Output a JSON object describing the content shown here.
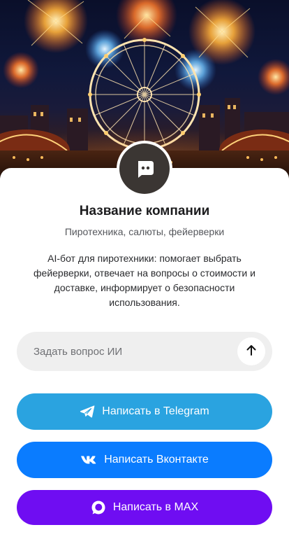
{
  "profile": {
    "name": "Название компании",
    "subtitle": "Пиротехника, салюты, фейерверки",
    "description": "AI-бот для пиротехники: помогает выбрать фейерверки, отвечает на вопросы о стоимости и доставке, информирует о безопасности использования."
  },
  "ask": {
    "placeholder": "Задать вопрос ИИ",
    "send_icon": "arrow-up-icon"
  },
  "buttons": {
    "telegram": {
      "label": "Написать в Telegram",
      "icon": "telegram-icon",
      "color": "#2aa3e0"
    },
    "vk": {
      "label": "Написать Вконтакте",
      "icon": "vk-icon",
      "color": "#0a7cff"
    },
    "max": {
      "label": "Написать в MAX",
      "icon": "max-icon",
      "color": "#6f0df2"
    }
  },
  "hero": {
    "image": "fireworks-ferris-wheel-night"
  }
}
